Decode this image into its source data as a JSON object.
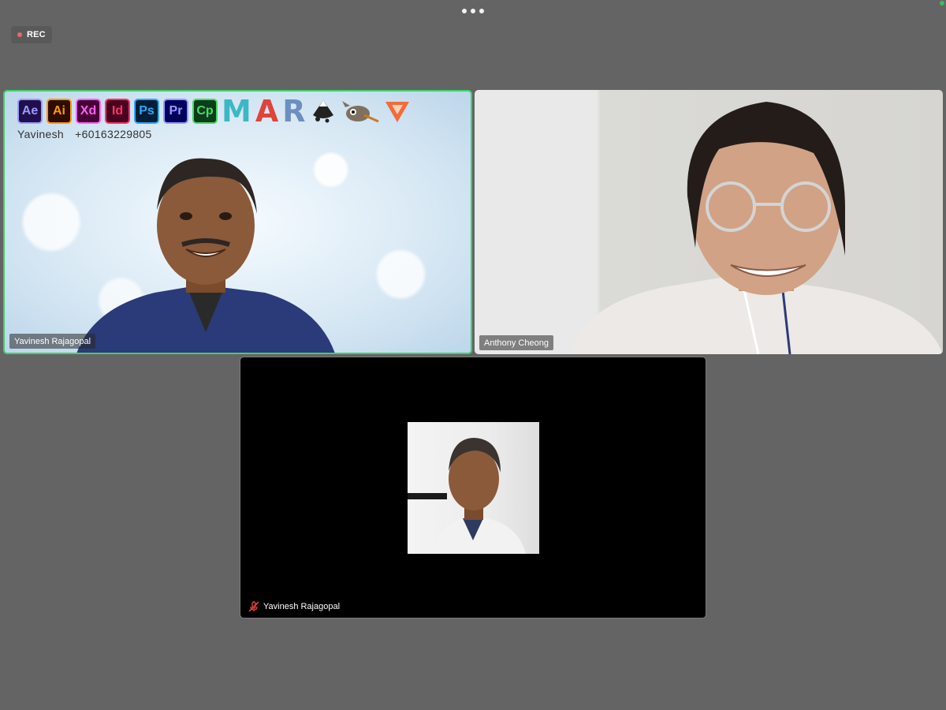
{
  "toolbar": {
    "more_icon": "more-horizontal-icon",
    "recording_label": "REC",
    "recording_color": "#e36a6a"
  },
  "active_speaker_color": "#3ed16c",
  "participants": [
    {
      "name": "Yavinesh Rajagopal",
      "video": "on",
      "active_speaker": true,
      "banner": {
        "apps": [
          {
            "label": "Ae",
            "bg": "#1f0f4d",
            "fg": "#9c9cff"
          },
          {
            "label": "Ai",
            "bg": "#2e0c00",
            "fg": "#ff9a00"
          },
          {
            "label": "Xd",
            "bg": "#470137",
            "fg": "#ff61f6"
          },
          {
            "label": "Id",
            "bg": "#49021f",
            "fg": "#ff3366"
          },
          {
            "label": "Ps",
            "bg": "#001e36",
            "fg": "#31a8ff"
          },
          {
            "label": "Pr",
            "bg": "#00005b",
            "fg": "#9999ff"
          },
          {
            "label": "Cp",
            "bg": "#0b3d1a",
            "fg": "#4cd964"
          },
          {
            "label": "M",
            "color": "#3cb8c4"
          },
          {
            "label": "A",
            "color": "#e0433a"
          },
          {
            "label": "R",
            "color": "#6d8fbf"
          }
        ],
        "extra_icons": [
          "inkscape-icon",
          "gimp-icon",
          "affinity-icon"
        ],
        "contact_name": "Yavinesh",
        "contact_phone": "+60163229805"
      }
    },
    {
      "name": "Anthony Cheong",
      "video": "on",
      "active_speaker": false
    },
    {
      "name": "Yavinesh Rajagopal",
      "video": "off",
      "muted": true,
      "mic_icon": "mic-off-icon"
    }
  ]
}
